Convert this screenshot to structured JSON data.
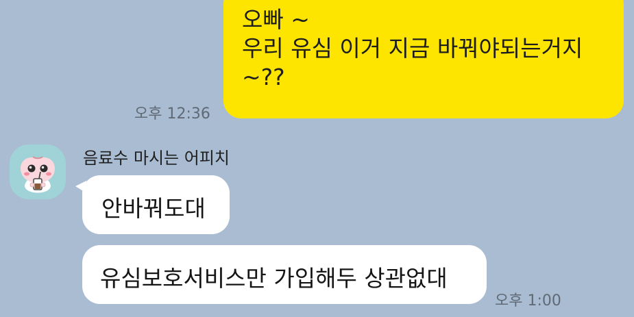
{
  "chat": {
    "outgoing": {
      "text": "오빠 ~\n우리 유심 이거 지금 바꿔야되는거지\n~??",
      "time": "오후 12:36"
    },
    "incoming": {
      "sender_name": "음료수 마시는 어피치",
      "avatar_icon": "apeach-drinking-avatar-icon",
      "messages": [
        {
          "text": "안바꿔도대"
        },
        {
          "text": "유심보호서비스만 가입해두 상관없대",
          "time": "오후 1:00"
        }
      ]
    }
  },
  "colors": {
    "background": "#a9bcd2",
    "outgoing_bubble": "#fee500",
    "incoming_bubble": "#ffffff",
    "timestamp": "#5f6a76"
  }
}
